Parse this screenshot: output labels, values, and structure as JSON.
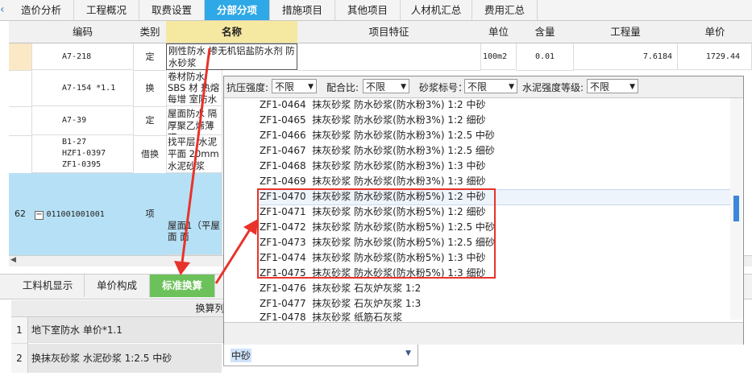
{
  "tabs": [
    "造价分析",
    "工程概况",
    "取费设置",
    "分部分项",
    "措施项目",
    "其他项目",
    "人材机汇总",
    "费用汇总"
  ],
  "grid": {
    "headers": [
      "编码",
      "类别",
      "名称",
      "项目特征",
      "单位",
      "含量",
      "工程量",
      "单价"
    ],
    "rows": [
      {
        "code": "A7-218",
        "type": "定",
        "name": "刚性防水 掺无机铝盐防水剂 防水砂浆",
        "unit": "100m2",
        "qty_ratio": "0.01",
        "amount": "7.6184",
        "price": "1729.44"
      },
      {
        "code": "A7-154 *1.1",
        "type": "换",
        "name": "卷材防水 SBS 材 热熔每增 室防水 单价"
      },
      {
        "code": "A7-39",
        "type": "定",
        "name": "屋面防水 隔 厚聚乙烯薄膜"
      },
      {
        "code": "B1-27\nHZF1-0397\nZF1-0395",
        "type": "借换",
        "name": "找平层 水泥 平面 20mm 水泥砂浆 1:2"
      },
      {
        "num": "62",
        "code": "011001001001",
        "type": "项",
        "name": "屋面1（平屋面 面"
      }
    ]
  },
  "bottom_tabs": [
    "工料机显示",
    "单价构成",
    "标准换算"
  ],
  "calc": {
    "header": "换算列表",
    "rows": [
      {
        "num": "1",
        "text": "地下室防水 单价*1.1"
      },
      {
        "num": "2",
        "text": "换抹灰砂浆 水泥砂浆 1:2.5 中砂"
      }
    ],
    "dropdown_value": "中砂"
  },
  "popup": {
    "filters": [
      {
        "label": "抗压强度:",
        "value": "不限"
      },
      {
        "label": "配合比:",
        "value": "不限"
      },
      {
        "label": "砂浆标号：",
        "value": "不限"
      },
      {
        "label": "水泥强度等级:",
        "value": "不限"
      }
    ],
    "items": [
      {
        "code": "ZF1-0464",
        "name": "抹灰砂浆 防水砂浆(防水粉3%) 1:2 中砂"
      },
      {
        "code": "ZF1-0465",
        "name": "抹灰砂浆 防水砂浆(防水粉3%) 1:2 细砂"
      },
      {
        "code": "ZF1-0466",
        "name": "抹灰砂浆 防水砂浆(防水粉3%) 1:2.5 中砂"
      },
      {
        "code": "ZF1-0467",
        "name": "抹灰砂浆 防水砂浆(防水粉3%) 1:2.5 细砂"
      },
      {
        "code": "ZF1-0468",
        "name": "抹灰砂浆 防水砂浆(防水粉3%) 1:3 中砂"
      },
      {
        "code": "ZF1-0469",
        "name": "抹灰砂浆 防水砂浆(防水粉3%) 1:3 细砂"
      },
      {
        "code": "ZF1-0470",
        "name": "抹灰砂浆 防水砂浆(防水粉5%) 1:2 中砂"
      },
      {
        "code": "ZF1-0471",
        "name": "抹灰砂浆 防水砂浆(防水粉5%) 1:2 细砂"
      },
      {
        "code": "ZF1-0472",
        "name": "抹灰砂浆 防水砂浆(防水粉5%) 1:2.5 中砂"
      },
      {
        "code": "ZF1-0473",
        "name": "抹灰砂浆 防水砂浆(防水粉5%) 1:2.5 细砂"
      },
      {
        "code": "ZF1-0474",
        "name": "抹灰砂浆 防水砂浆(防水粉5%) 1:3 中砂"
      },
      {
        "code": "ZF1-0475",
        "name": "抹灰砂浆 防水砂浆(防水粉5%) 1:3 细砂"
      },
      {
        "code": "ZF1-0476",
        "name": "抹灰砂浆 石灰炉灰浆 1:2"
      },
      {
        "code": "ZF1-0477",
        "name": "抹灰砂浆 石灰炉灰浆 1:3"
      },
      {
        "code": "ZF1-0478",
        "name": "抹灰砂浆 纸筋石灰浆"
      }
    ]
  },
  "colors": {
    "active_tab": "#2ea8e6",
    "active_bottom_tab": "#6cc15a",
    "annotation": "#e8332a",
    "selected_row": "#b6e0f5"
  }
}
